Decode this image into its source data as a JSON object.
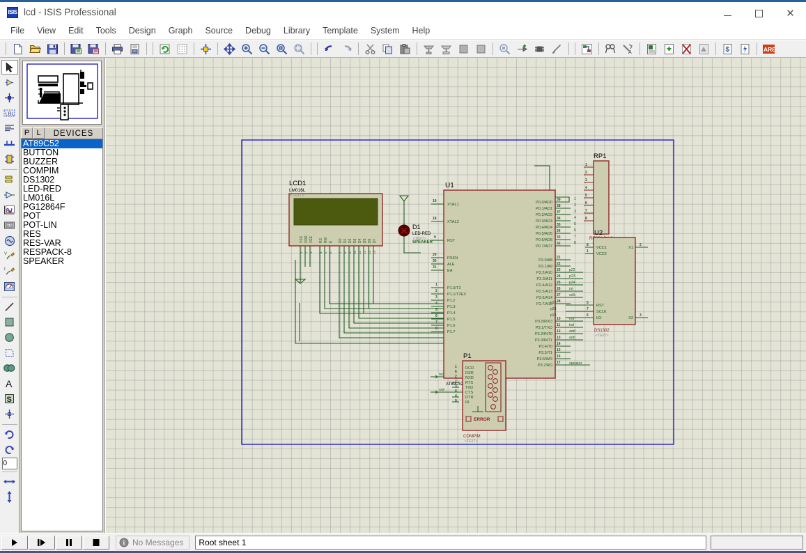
{
  "window": {
    "title": "lcd - ISIS Professional",
    "app_icon": "ISIS",
    "minimize": "—",
    "maximize": "□",
    "close": "✕"
  },
  "menubar": {
    "items": [
      "File",
      "View",
      "Edit",
      "Tools",
      "Design",
      "Graph",
      "Source",
      "Debug",
      "Library",
      "Template",
      "System",
      "Help"
    ]
  },
  "toolbar": {
    "groups": [
      [
        "new-file-icon",
        "open-file-icon",
        "save-file-icon"
      ],
      [
        "import-section-icon",
        "export-section-icon"
      ],
      [
        "print-icon",
        "print-area-icon"
      ],
      [
        "refresh-icon",
        "toggle-grid-icon"
      ],
      [
        "origin-icon"
      ],
      [
        "pan-icon",
        "zoom-in-icon",
        "zoom-out-icon",
        "zoom-sheet-icon",
        "zoom-area-icon"
      ],
      [
        "undo-icon",
        "redo-icon"
      ],
      [
        "cut-icon",
        "copy-icon",
        "paste-icon"
      ],
      [
        "block-copy-icon",
        "block-move-icon",
        "block-rotate-icon",
        "block-delete-icon"
      ],
      [
        "pick-device-icon",
        "make-device-icon",
        "packaging-tool-icon",
        "decompose-icon"
      ],
      [
        "wire-label-icon"
      ],
      [
        "property-assign-icon",
        "design-explorer-icon"
      ],
      [
        "new-sheet-icon",
        "remove-sheet-icon",
        "exit-sheet-icon"
      ],
      [
        "bill-of-materials-icon",
        "electrical-rule-check-icon"
      ],
      [
        "ares-netlist-icon"
      ]
    ]
  },
  "toolstrip": {
    "items": [
      {
        "name": "selection-mode-icon",
        "selected": true
      },
      {
        "name": "component-mode-icon",
        "selected": false
      },
      {
        "name": "junction-dot-icon",
        "selected": false
      },
      {
        "name": "wire-label-mode-icon",
        "selected": false
      },
      {
        "name": "text-script-icon",
        "selected": false
      },
      {
        "name": "bus-mode-icon",
        "selected": false
      },
      {
        "name": "subcircuit-icon",
        "selected": false
      },
      {
        "name": "terminals-mode-icon",
        "selected": false
      },
      {
        "name": "device-pin-icon",
        "selected": false
      },
      {
        "name": "graph-mode-icon",
        "selected": false
      },
      {
        "name": "tape-recorder-icon",
        "selected": false
      },
      {
        "name": "generator-mode-icon",
        "selected": false
      },
      {
        "name": "voltage-probe-icon",
        "selected": false
      },
      {
        "name": "current-probe-icon",
        "selected": false
      },
      {
        "name": "virtual-instrument-icon",
        "selected": false
      },
      {
        "name": "line-tool-icon",
        "selected": false
      },
      {
        "name": "box-tool-icon",
        "selected": false
      },
      {
        "name": "circle-tool-icon",
        "selected": false
      },
      {
        "name": "arc-tool-icon",
        "selected": false
      },
      {
        "name": "closed-path-tool-icon",
        "selected": false
      },
      {
        "name": "text-tool-icon",
        "selected": false
      },
      {
        "name": "symbol-tool-icon",
        "selected": false
      },
      {
        "name": "marker-tool-icon",
        "selected": false
      },
      {
        "name": "rotate-clockwise-icon",
        "selected": false
      },
      {
        "name": "rotate-anticlockwise-icon",
        "selected": false
      }
    ],
    "rotation_value": "0",
    "mirror_x_icon": "mirror-horizontal-icon",
    "mirror_y_icon": "mirror-vertical-icon"
  },
  "devices_panel": {
    "tab_p": "P",
    "tab_l": "L",
    "title": "DEVICES",
    "items": [
      {
        "label": "AT89C52",
        "selected": true
      },
      {
        "label": "BUTTON",
        "selected": false
      },
      {
        "label": "BUZZER",
        "selected": false
      },
      {
        "label": "COMPIM",
        "selected": false
      },
      {
        "label": "DS1302",
        "selected": false
      },
      {
        "label": "LED-RED",
        "selected": false
      },
      {
        "label": "LM016L",
        "selected": false
      },
      {
        "label": "PG12864F",
        "selected": false
      },
      {
        "label": "POT",
        "selected": false
      },
      {
        "label": "POT-LIN",
        "selected": false
      },
      {
        "label": "RES",
        "selected": false
      },
      {
        "label": "RES-VAR",
        "selected": false
      },
      {
        "label": "RESPACK-8",
        "selected": false
      },
      {
        "label": "SPEAKER",
        "selected": false
      }
    ]
  },
  "statusbar": {
    "play": "▶",
    "step": "▐▶",
    "pause": "❚❚",
    "stop": "■",
    "message": "No Messages",
    "sheet": "Root sheet 1",
    "coords": ""
  },
  "schematic": {
    "colors": {
      "background": "#e3e4d5",
      "grid": "#969696",
      "border": "#2020c8",
      "component_outline": "#8b2020",
      "component_fill": "#cdcdb0",
      "wire": "#1f5a1f",
      "pin_text": "#1f5a1f",
      "label_text": "#000000",
      "hidden_text": "#808080",
      "lcd_screen": "#4c5a10",
      "led_body": "#5a0000"
    },
    "components": [
      {
        "ref": "LCD1",
        "value": "LM016L",
        "hidden": "<TEXT>",
        "type": "lcd-display",
        "pins_bottom": [
          "VSS",
          "VDD",
          "VEE",
          "RS",
          "RW",
          "E",
          "D0",
          "D1",
          "D2",
          "D3",
          "D4",
          "D5",
          "D6",
          "D7"
        ],
        "pin_numbers_bottom": [
          "1",
          "2",
          "3",
          "4",
          "5",
          "6",
          "7",
          "8",
          "9",
          "10",
          "11",
          "12",
          "13",
          "14"
        ]
      },
      {
        "ref": "D1",
        "value": "LED-RED",
        "hidden": "<TEXT>",
        "type": "led",
        "net": "SPEAKER"
      },
      {
        "ref": "U1",
        "value": "AT89C52",
        "type": "microcontroller",
        "pins_left": [
          {
            "num": "19",
            "name": "XTAL1"
          },
          {
            "num": "18",
            "name": "XTAL2"
          },
          {
            "num": "9",
            "name": "RST"
          },
          {
            "num": "29",
            "name": "PSEN"
          },
          {
            "num": "30",
            "name": "ALE"
          },
          {
            "num": "31",
            "name": "EA"
          },
          {
            "num": "1",
            "name": "P1.0/T2"
          },
          {
            "num": "2",
            "name": "P1.1/T2EX"
          },
          {
            "num": "3",
            "name": "P1.2"
          },
          {
            "num": "4",
            "name": "P1.3"
          },
          {
            "num": "5",
            "name": "P1.4"
          },
          {
            "num": "6",
            "name": "P1.5"
          },
          {
            "num": "7",
            "name": "P1.6"
          },
          {
            "num": "8",
            "name": "P1.7"
          }
        ],
        "pins_right": [
          {
            "num": "39",
            "name": "P0.0/AD0",
            "net": "1"
          },
          {
            "num": "38",
            "name": "P0.1/AD1",
            "net": "2"
          },
          {
            "num": "37",
            "name": "P0.2/AD2",
            "net": "3"
          },
          {
            "num": "36",
            "name": "P0.3/AD3",
            "net": "4"
          },
          {
            "num": "35",
            "name": "P0.4/AD4",
            "net": "5"
          },
          {
            "num": "34",
            "name": "P0.5/AD5",
            "net": "6"
          },
          {
            "num": "33",
            "name": "P0.6/AD6",
            "net": "7"
          },
          {
            "num": "32",
            "name": "P0.7/AD7",
            "net": "8"
          },
          {
            "num": "21",
            "name": "P2.0/A8",
            "net": ""
          },
          {
            "num": "22",
            "name": "P2.1/A9",
            "net": ""
          },
          {
            "num": "23",
            "name": "P2.2/A10",
            "net": "p22"
          },
          {
            "num": "24",
            "name": "P2.3/A11",
            "net": "p23"
          },
          {
            "num": "25",
            "name": "P2.4/A12",
            "net": "p24"
          },
          {
            "num": "26",
            "name": "P2.5/A13",
            "net": "rst"
          },
          {
            "num": "27",
            "name": "P2.6/A14",
            "net": "sclk"
          },
          {
            "num": "28",
            "name": "P2.7/A15",
            "net": ""
          },
          {
            "num": "10",
            "name": "P3.0/RXD",
            "net": "rxd"
          },
          {
            "num": "11",
            "name": "P3.1/TXD",
            "net": "txd"
          },
          {
            "num": "12",
            "name": "P3.2/INT0",
            "net": "add"
          },
          {
            "num": "13",
            "name": "P3.3/INT1",
            "net": "add"
          },
          {
            "num": "14",
            "name": "P3.4/T0",
            "net": ""
          },
          {
            "num": "15",
            "name": "P3.5/T1",
            "net": ""
          },
          {
            "num": "16",
            "name": "P3.6/WR",
            "net": ""
          },
          {
            "num": "17",
            "name": "P3.7/RD",
            "net": "speaker"
          }
        ]
      },
      {
        "ref": "RP1",
        "value": "RESPACK-8",
        "hidden": "<TEXT>",
        "type": "resistor-pack",
        "pin_numbers": [
          "1",
          "2",
          "3",
          "4",
          "5",
          "6",
          "7",
          "8"
        ]
      },
      {
        "ref": "U2",
        "value": "DS1302",
        "hidden": "<TEXT>",
        "type": "rtc",
        "pins_left": [
          {
            "num": "8",
            "name": "VCC1"
          },
          {
            "num": "1",
            "name": "VCC2"
          },
          {
            "num": "5",
            "name": "RST"
          },
          {
            "num": "7",
            "name": "SCLK"
          },
          {
            "num": "6",
            "name": "I/O"
          }
        ],
        "pins_right": [
          {
            "num": "2",
            "name": "X1"
          },
          {
            "num": "3",
            "name": "X2"
          }
        ],
        "nets_left": [
          "p22",
          "p24",
          "p23"
        ]
      },
      {
        "ref": "P1",
        "value": "COMPIM",
        "hidden": "<TEXT>",
        "type": "serial-port",
        "pins": [
          {
            "num": "1",
            "name": "DCD"
          },
          {
            "num": "6",
            "name": "DSR"
          },
          {
            "num": "2",
            "name": "RXD"
          },
          {
            "num": "7",
            "name": "RTS"
          },
          {
            "num": "3",
            "name": "TXD"
          },
          {
            "num": "8",
            "name": "CTS"
          },
          {
            "num": "4",
            "name": "DTR"
          },
          {
            "num": "9",
            "name": "RI"
          }
        ],
        "error_label": "ERROR",
        "nets": [
          "txd",
          "rxd"
        ]
      }
    ]
  }
}
